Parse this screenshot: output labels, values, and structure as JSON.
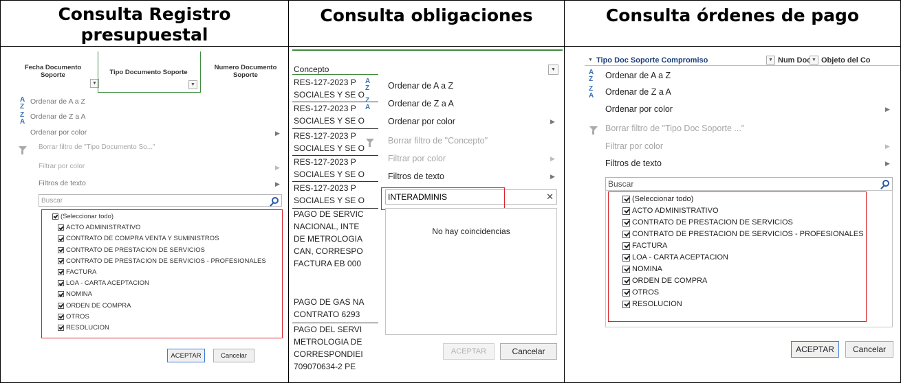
{
  "headers": {
    "left": "Consulta Registro presupuestal",
    "middle": "Consulta obligaciones",
    "right": "Consulta órdenes de pago"
  },
  "left_panel": {
    "col_headers": [
      "Fecha Documento Soporte",
      "Tipo Documento Soporte",
      "Numero Documento Soporte"
    ],
    "menu": {
      "sort_asc": "Ordenar de A a Z",
      "sort_desc": "Ordenar de Z a A",
      "sort_color": "Ordenar por color",
      "clear_filter": "Borrar filtro de \"Tipo Documento So...\"",
      "filter_color": "Filtrar por color",
      "text_filters": "Filtros de texto"
    },
    "search_placeholder": "Buscar",
    "items": [
      "(Seleccionar todo)",
      "ACTO ADMINISTRATIVO",
      "CONTRATO DE COMPRA VENTA Y SUMINISTROS",
      "CONTRATO DE PRESTACION DE SERVICIOS",
      "CONTRATO DE PRESTACION DE SERVICIOS - PROFESIONALES",
      "FACTURA",
      "LOA - CARTA ACEPTACION",
      "NOMINA",
      "ORDEN DE COMPRA",
      "OTROS",
      "RESOLUCION"
    ],
    "ok_label": "ACEPTAR",
    "cancel_label": "Cancelar"
  },
  "middle_panel": {
    "col_header": "Concepto",
    "cells": [
      "RES-127-2023 P",
      "SOCIALES Y SE O",
      "RES-127-2023 P",
      "SOCIALES Y SE O",
      "RES-127-2023 P",
      "SOCIALES Y SE O",
      "RES-127-2023 P",
      "SOCIALES Y SE O",
      "RES-127-2023 P",
      "SOCIALES Y SE O",
      "PAGO DE SERVIC",
      "NACIONAL, INTE",
      "DE METROLOGIA",
      "CAN, CORRESPO",
      "FACTURA EB 000",
      "",
      "",
      "PAGO DE GAS NA",
      "CONTRATO 6293",
      "PAGO DEL SERVI",
      "METROLOGIA DE",
      "CORRESPONDIEI",
      "709070634-2 PE"
    ],
    "menu": {
      "sort_asc": "Ordenar de A a Z",
      "sort_desc": "Ordenar de Z a A",
      "sort_color": "Ordenar por color",
      "clear_filter": "Borrar filtro de \"Concepto\"",
      "filter_color": "Filtrar por color",
      "text_filters": "Filtros de texto"
    },
    "search_value": "INTERADMINIS",
    "no_match": "No hay coincidencias",
    "ok_label": "ACEPTAR",
    "cancel_label": "Cancelar"
  },
  "right_panel": {
    "col_headers": [
      "Tipo Doc Soporte Compromiso",
      "Num Doc",
      "Objeto del Co"
    ],
    "menu": {
      "sort_asc": "Ordenar de A a Z",
      "sort_desc": "Ordenar de Z a A",
      "sort_color": "Ordenar por color",
      "clear_filter": "Borrar filtro de \"Tipo Doc Soporte ...\"",
      "filter_color": "Filtrar por color",
      "text_filters": "Filtros de texto"
    },
    "search_placeholder": "Buscar",
    "items": [
      "(Seleccionar todo)",
      "ACTO ADMINISTRATIVO",
      "CONTRATO DE PRESTACION DE SERVICIOS",
      "CONTRATO DE PRESTACION DE SERVICIOS - PROFESIONALES",
      "FACTURA",
      "LOA - CARTA ACEPTACION",
      "NOMINA",
      "ORDEN DE COMPRA",
      "OTROS",
      "RESOLUCION"
    ],
    "ok_label": "ACEPTAR",
    "cancel_label": "Cancelar"
  },
  "colors": {
    "highlight": "#d8242a",
    "accent": "#3b7ddb",
    "disabled": "#a6a6a6"
  }
}
